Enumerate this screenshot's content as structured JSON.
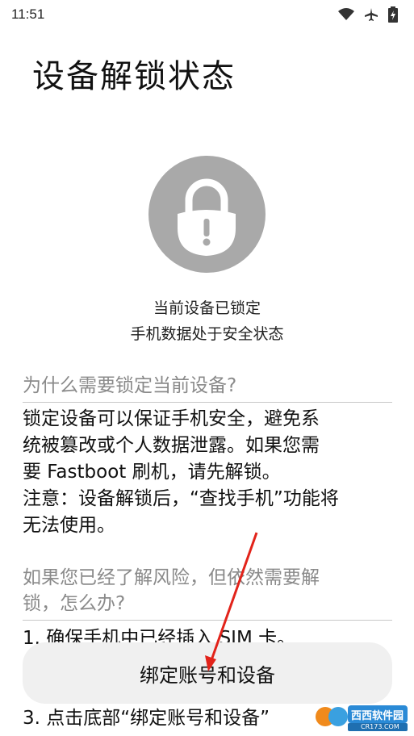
{
  "status_bar": {
    "time": "11:51",
    "icons": [
      "wifi-icon",
      "airplane-icon",
      "battery-icon"
    ]
  },
  "page": {
    "title": "设备解锁状态"
  },
  "lock": {
    "icon": "lock-icon",
    "circle_color": "#a9a9a9",
    "status_line1": "当前设备已锁定",
    "status_line2": "手机数据处于安全状态"
  },
  "why_section": {
    "heading": "为什么需要锁定当前设备?",
    "body_line1": "锁定设备可以保证手机安全，避免系",
    "body_line2": "统被篡改或个人数据泄露。如果您需",
    "body_line3": "要 Fastboot 刷机，请先解锁。",
    "body_line4": "注意：设备解锁后，“查找手机”功能将",
    "body_line5": "无法使用。"
  },
  "how_section": {
    "heading_line1": "如果您已经了解风险，但依然需要解",
    "heading_line2": "锁，怎么办?",
    "step1": "1. 确保手机中已经插入 SIM 卡。",
    "step3_partial": "3. 点击底部“绑定账号和设备”"
  },
  "bottom_button": {
    "label": "绑定账号和设备"
  },
  "watermark": {
    "text": "西西软件园",
    "subtext": "CR173.COM"
  }
}
